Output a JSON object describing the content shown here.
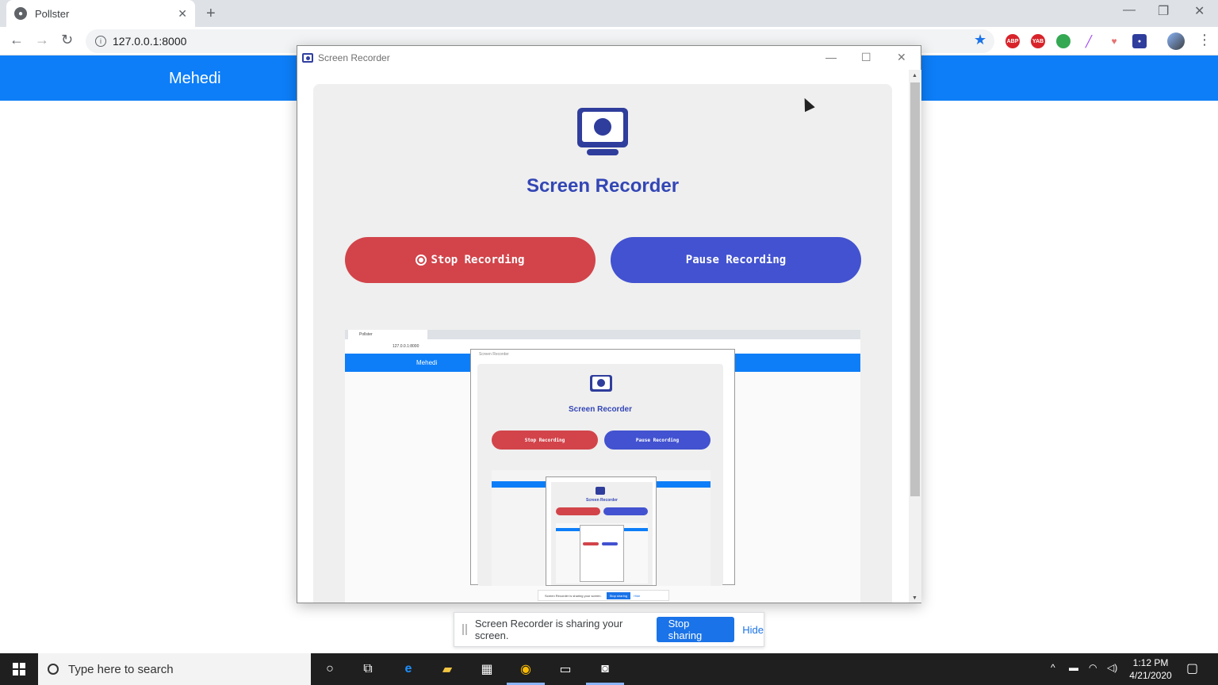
{
  "browser": {
    "tab_title": "Pollster",
    "url": "127.0.0.1:8000",
    "extensions": [
      "ABP",
      "YAB"
    ]
  },
  "page": {
    "brand": "Mehedi"
  },
  "popup": {
    "title": "Screen Recorder",
    "app_title": "Screen Recorder",
    "stop_label": "Stop Recording",
    "pause_label": "Pause Recording",
    "colors": {
      "stop": "#d2444a",
      "pause": "#4252d0",
      "title": "#3346b5"
    }
  },
  "preview": {
    "tab_title": "Pollster",
    "url": "127.0.0.1:8000",
    "brand": "Mehedi",
    "window_title": "Screen Recorder",
    "app_title": "Screen Recorder",
    "stop_label": "Stop Recording",
    "pause_label": "Pause Recording",
    "share_text": "Screen Recorder is sharing your screen.",
    "share_stop": "Stop sharing",
    "share_hide": "Hide"
  },
  "share_bar": {
    "text": "Screen Recorder is sharing your screen.",
    "stop_label": "Stop sharing",
    "hide_label": "Hide"
  },
  "taskbar": {
    "search_placeholder": "Type here to search",
    "time": "1:12 PM",
    "date": "4/21/2020"
  }
}
